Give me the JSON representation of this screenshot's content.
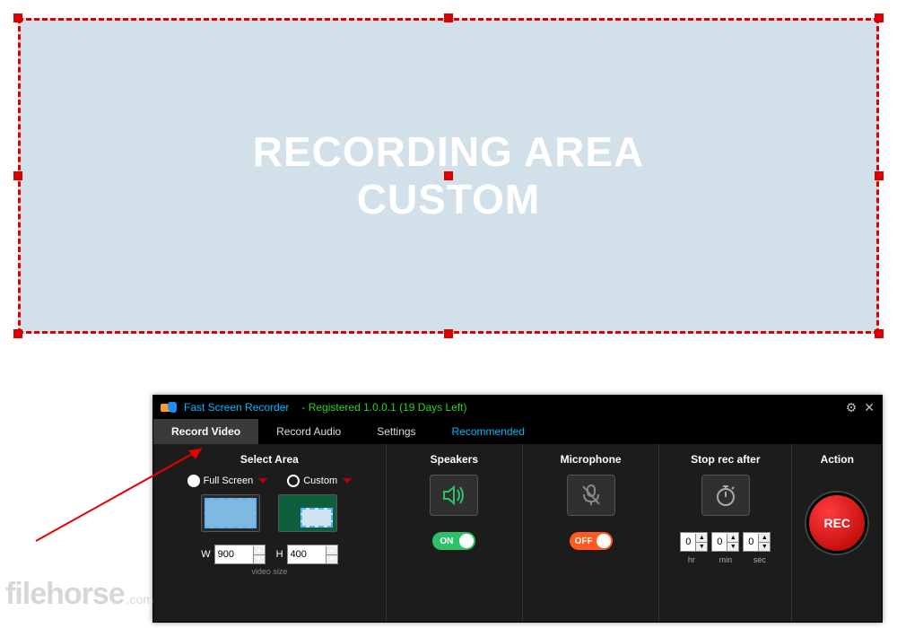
{
  "recording_area": {
    "text": "RECORDING AREA\nCUSTOM"
  },
  "app": {
    "title": "Fast Screen Recorder",
    "registration": "- Registered 1.0.0.1 (19 Days Left)",
    "tabs": {
      "record_video": "Record Video",
      "record_audio": "Record Audio",
      "settings": "Settings",
      "recommended": "Recommended"
    },
    "select_area": {
      "header": "Select Area",
      "full_screen_label": "Full Screen",
      "custom_label": "Custom",
      "selected": "custom",
      "width_label": "W",
      "height_label": "H",
      "width_value": "900",
      "height_value": "400",
      "video_size_label": "video size"
    },
    "speakers": {
      "header": "Speakers",
      "toggle_label": "ON",
      "state": "on"
    },
    "microphone": {
      "header": "Microphone",
      "toggle_label": "OFF",
      "state": "off"
    },
    "stop_after": {
      "header": "Stop rec after",
      "hr": "0",
      "min": "0",
      "sec": "0",
      "hr_label": "hr",
      "min_label": "min",
      "sec_label": "sec"
    },
    "action": {
      "header": "Action",
      "rec_label": "REC"
    }
  },
  "watermark": {
    "name": "filehorse",
    "tld": ".com"
  }
}
